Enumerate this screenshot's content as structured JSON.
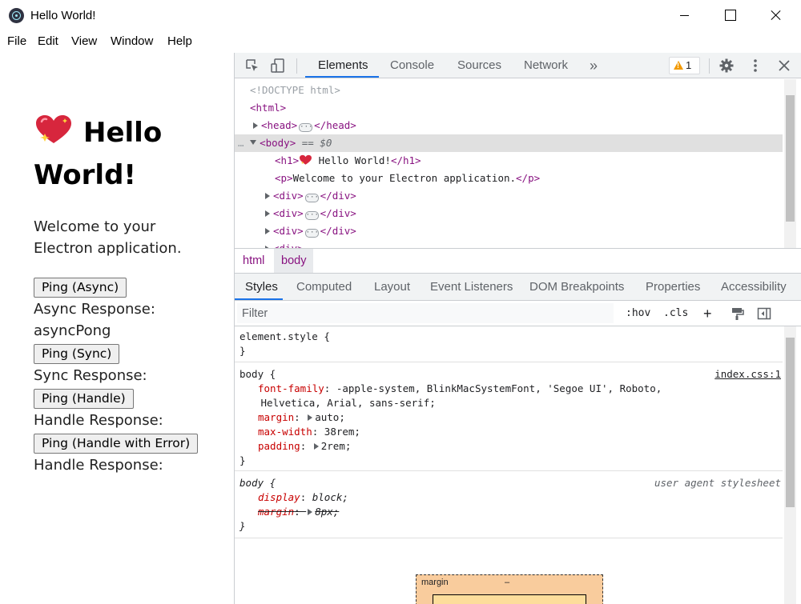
{
  "window": {
    "title": "Hello World!"
  },
  "menu": [
    "File",
    "Edit",
    "View",
    "Window",
    "Help"
  ],
  "app": {
    "heading": "Hello World!",
    "paragraph": "Welcome to your Electron application.",
    "buttons": {
      "ping_async": "Ping (Async)",
      "ping_sync": "Ping (Sync)",
      "ping_handle": "Ping (Handle)",
      "ping_handle_error": "Ping (Handle with Error)"
    },
    "responses": {
      "async_label": "Async Response:",
      "async_value": "asyncPong",
      "sync_label": "Sync Response:",
      "handle_label": "Handle Response:",
      "handle_error_label": "Handle Response:"
    }
  },
  "devtools": {
    "tabs": [
      "Elements",
      "Console",
      "Sources",
      "Network"
    ],
    "more_tabs": "»",
    "warnings_count": "1",
    "dom": {
      "doctype": "<!DOCTYPE html>",
      "html_open": "<html>",
      "head": {
        "open": "<head>",
        "close": "</head>"
      },
      "body_open": "<body>",
      "body_marker": "== $0",
      "h1_open": "<h1>",
      "h1_text": "Hello World!",
      "h1_close": "</h1>",
      "p_open": "<p>",
      "p_text": "Welcome to your Electron application.",
      "p_close": "</p>",
      "div_open": "<div>",
      "div_close": "</div>",
      "gutter_dots": "…"
    },
    "breadcrumb": [
      "html",
      "body"
    ],
    "style_tabs": [
      "Styles",
      "Computed",
      "Layout",
      "Event Listeners",
      "DOM Breakpoints",
      "Properties",
      "Accessibility"
    ],
    "filter": {
      "placeholder": "Filter",
      "hov": ":hov",
      "cls": ".cls",
      "add": "+"
    },
    "rules": {
      "element_style": {
        "selector": "element.style {",
        "close": "}"
      },
      "body_css": {
        "selector": "body {",
        "source": "index.css:1",
        "font_family_prop": "font-family",
        "font_family_val1": "-apple-system, BlinkMacSystemFont, 'Segoe UI', Roboto,",
        "font_family_val2": "Helvetica, Arial, sans-serif;",
        "margin_prop": "margin",
        "margin_val": "auto;",
        "max_width_prop": "max-width",
        "max_width_val": "38rem;",
        "padding_prop": "padding",
        "padding_val": "2rem;",
        "close": "}"
      },
      "body_ua": {
        "selector": "body {",
        "source": "user agent stylesheet",
        "display_prop": "display",
        "display_val": "block;",
        "margin_prop": "margin",
        "margin_val": "8px;",
        "close": "}"
      }
    },
    "box_model": {
      "margin_label": "margin",
      "margin_value": "–"
    }
  }
}
